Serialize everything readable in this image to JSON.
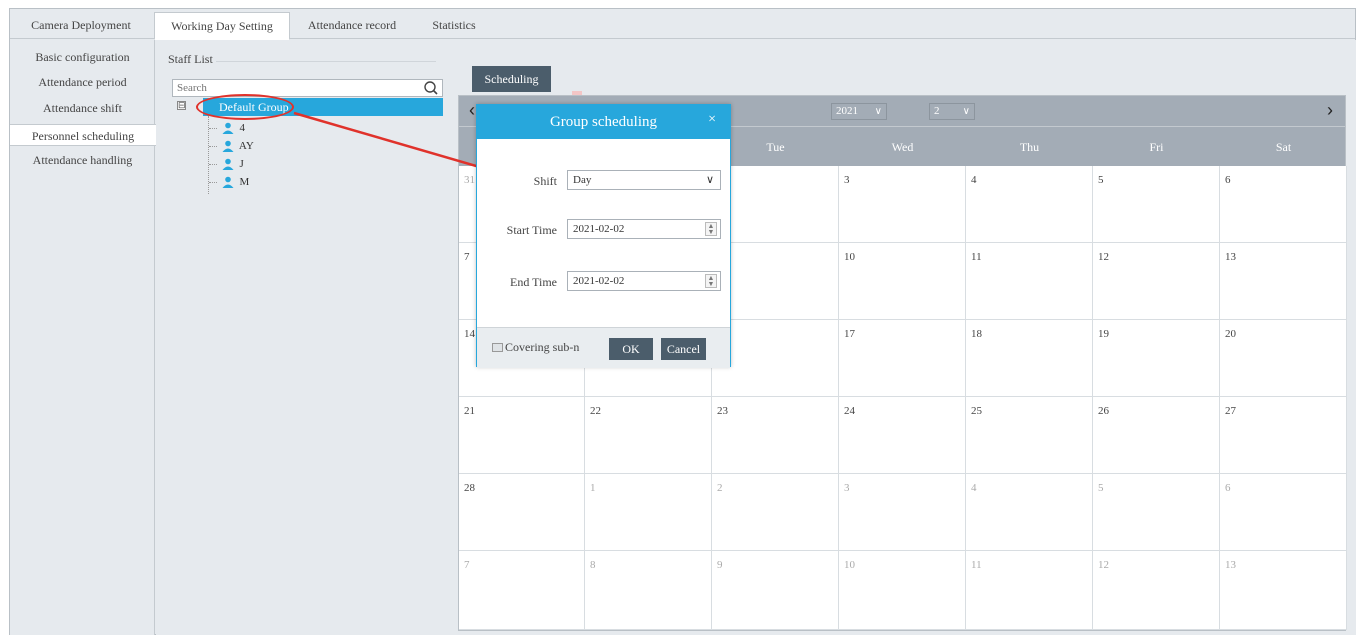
{
  "tabs": [
    "Camera Deployment",
    "Working Day Setting",
    "Attendance record",
    "Statistics"
  ],
  "active_tab": "Working Day Setting",
  "sidebar": {
    "items": [
      {
        "label": "Basic configuration"
      },
      {
        "label": "Attendance period"
      },
      {
        "label": "Attendance shift"
      },
      {
        "label": "Personnel scheduling"
      },
      {
        "label": "Attendance handling"
      }
    ],
    "active": "Personnel scheduling"
  },
  "staff": {
    "title": "Staff List",
    "search_placeholder": "Search",
    "group": {
      "expander": "⊟",
      "label": "Default Group"
    },
    "members": [
      "4",
      "AY",
      "J",
      "M"
    ]
  },
  "scheduling_button": "Scheduling",
  "calendar": {
    "year": "2021",
    "month": "2",
    "weekdays": [
      "",
      "",
      "Tue",
      "Wed",
      "Thu",
      "Fri",
      "Sat"
    ],
    "weeks": [
      [
        {
          "d": "31",
          "dim": true
        },
        {
          "d": "",
          "dim": false
        },
        {
          "d": "",
          "dim": false
        },
        {
          "d": "3",
          "dim": false
        },
        {
          "d": "4",
          "dim": false
        },
        {
          "d": "5",
          "dim": false
        },
        {
          "d": "6",
          "dim": false
        }
      ],
      [
        {
          "d": "7",
          "dim": false
        },
        {
          "d": "",
          "dim": false
        },
        {
          "d": "",
          "dim": false
        },
        {
          "d": "10",
          "dim": false
        },
        {
          "d": "11",
          "dim": false
        },
        {
          "d": "12",
          "dim": false
        },
        {
          "d": "13",
          "dim": false
        }
      ],
      [
        {
          "d": "14",
          "dim": false
        },
        {
          "d": "",
          "dim": false
        },
        {
          "d": "",
          "dim": false
        },
        {
          "d": "17",
          "dim": false
        },
        {
          "d": "18",
          "dim": false
        },
        {
          "d": "19",
          "dim": false
        },
        {
          "d": "20",
          "dim": false
        }
      ],
      [
        {
          "d": "21",
          "dim": false
        },
        {
          "d": "22",
          "dim": false
        },
        {
          "d": "23",
          "dim": false
        },
        {
          "d": "24",
          "dim": false
        },
        {
          "d": "25",
          "dim": false
        },
        {
          "d": "26",
          "dim": false
        },
        {
          "d": "27",
          "dim": false
        }
      ],
      [
        {
          "d": "28",
          "dim": false
        },
        {
          "d": "1",
          "dim": true
        },
        {
          "d": "2",
          "dim": true
        },
        {
          "d": "3",
          "dim": true
        },
        {
          "d": "4",
          "dim": true
        },
        {
          "d": "5",
          "dim": true
        },
        {
          "d": "6",
          "dim": true
        }
      ],
      [
        {
          "d": "7",
          "dim": true
        },
        {
          "d": "8",
          "dim": true
        },
        {
          "d": "9",
          "dim": true
        },
        {
          "d": "10",
          "dim": true
        },
        {
          "d": "11",
          "dim": true
        },
        {
          "d": "12",
          "dim": true
        },
        {
          "d": "13",
          "dim": true
        }
      ]
    ]
  },
  "dialog": {
    "title": "Group scheduling",
    "close_glyph": "×",
    "shift_label": "Shift",
    "shift_value": "Day",
    "start_label": "Start Time",
    "start_value": "2021-02-02",
    "end_label": "End Time",
    "end_value": "2021-02-02",
    "covering_label": "Covering sub-n",
    "ok_label": "OK",
    "cancel_label": "Cancel"
  },
  "colors": {
    "accent": "#27a7dc",
    "dark_button": "#4b5d6b",
    "calendar_header": "#a3acb6",
    "annotation": "#e0322b"
  }
}
